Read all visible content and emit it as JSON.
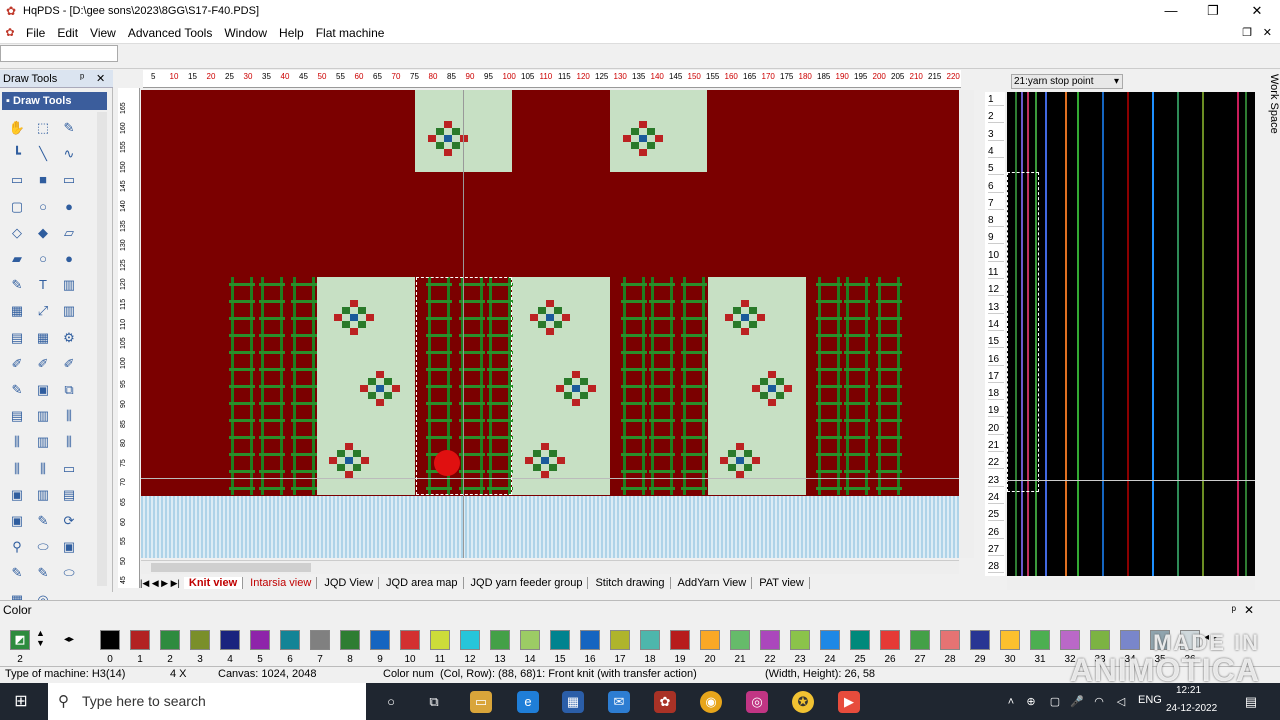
{
  "window": {
    "title": "HqPDS - [D:\\gee sons\\2023\\8GG\\S17-F40.PDS]",
    "minimize": "—",
    "restore": "❐",
    "close": "✕"
  },
  "menu": [
    "File",
    "Edit",
    "View",
    "Advanced Tools",
    "Window",
    "Help",
    "Flat machine"
  ],
  "draw_tools": {
    "panel_title": "Draw Tools",
    "pin": "ᵖ",
    "close": "✕",
    "section_title": "Draw Tools"
  },
  "ruler_top_labels": [
    "5",
    "10",
    "15",
    "20",
    "25",
    "30",
    "35",
    "40",
    "45",
    "50",
    "55",
    "60",
    "65",
    "70",
    "75",
    "80",
    "85",
    "90",
    "95",
    "100",
    "105",
    "110",
    "115",
    "120",
    "125",
    "130",
    "135",
    "140",
    "145",
    "150",
    "155",
    "160",
    "165",
    "170",
    "175",
    "180",
    "185",
    "190",
    "195",
    "200",
    "205",
    "210",
    "215",
    "220"
  ],
  "ruler_left_labels": [
    "165",
    "160",
    "155",
    "150",
    "145",
    "140",
    "135",
    "130",
    "125",
    "120",
    "115",
    "110",
    "105",
    "100",
    "95",
    "90",
    "85",
    "80",
    "75",
    "70",
    "65",
    "60",
    "55",
    "50",
    "45"
  ],
  "view_tabs": [
    "Knit view",
    "Intarsia view",
    "JQD View",
    "JQD area map",
    "JQD yarn feeder group",
    "Stitch drawing",
    "AddYarn View",
    "PAT view"
  ],
  "active_tab": "Knit view",
  "right_panel": {
    "dropdown": "21:yarn stop point",
    "row_numbers": [
      "1",
      "2",
      "3",
      "4",
      "5",
      "6",
      "7",
      "8",
      "9",
      "10",
      "11",
      "12",
      "13",
      "14",
      "15",
      "16",
      "17",
      "18",
      "19",
      "20",
      "21",
      "22",
      "23",
      "24",
      "25",
      "26",
      "27",
      "28"
    ],
    "work_space_label": "Work Space"
  },
  "color_panel": {
    "title": "Color",
    "indices": [
      "0",
      "1",
      "2",
      "3",
      "4",
      "5",
      "6",
      "7",
      "8",
      "9",
      "10",
      "11",
      "12",
      "13",
      "14",
      "15",
      "16",
      "17",
      "18",
      "19",
      "20",
      "21",
      "22",
      "23",
      "24",
      "25",
      "26",
      "27",
      "28",
      "29",
      "30",
      "31",
      "32",
      "33",
      "34",
      "35",
      "36"
    ],
    "current_index": "2",
    "swatch_colors": [
      "#000000",
      "#b22222",
      "#2e8b3e",
      "#7a8f2a",
      "#1a237e",
      "#8e24aa",
      "#138496",
      "#808080",
      "#2e7d32",
      "#1565c0",
      "#d32f2f",
      "#cddc39",
      "#26c6da",
      "#43a047",
      "#9ccc65",
      "#00838f",
      "#1565c0",
      "#afb42b",
      "#4db6ac",
      "#b71c1c",
      "#f9a825",
      "#66bb6a",
      "#ab47bc",
      "#8bc34a",
      "#1e88e5",
      "#00897b",
      "#e53935",
      "#43a047",
      "#e57373",
      "#283593",
      "#fbc02d",
      "#4caf50",
      "#ba68c8",
      "#7cb342",
      "#7986cb",
      "#90a4ae",
      "#cfd8dc"
    ]
  },
  "status": {
    "machine": "Type of machine: H3(14)",
    "zoom": "4 X",
    "canvas": "Canvas: 1024, 2048",
    "color_num": "Color num",
    "col_row": "(Col, Row): (88, 68)1: Front knit (with transfer action)",
    "size": "(Width, Height): 26, 58"
  },
  "taskbar": {
    "search_placeholder": "Type here to search",
    "lang": "ENG",
    "time": "12:21",
    "date": "24-12-2022"
  },
  "watermark": {
    "line1": "MADE IN",
    "line2": "ANIMOTICA"
  },
  "colors": {
    "canvas_bg": "#7b0000",
    "pane": "#c7e0c4",
    "ladder": "#1f7f1f",
    "selection_blue": "#3b5d9c"
  }
}
